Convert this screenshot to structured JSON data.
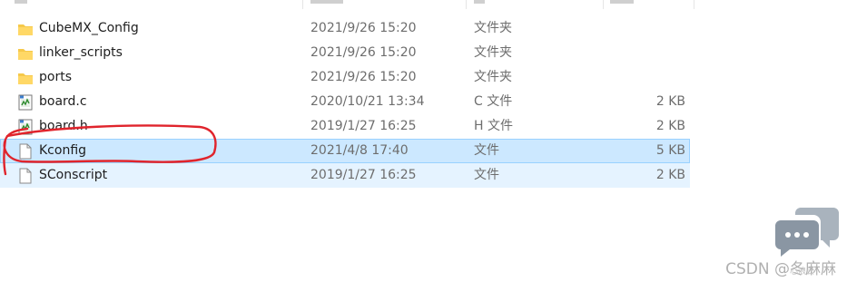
{
  "files": [
    {
      "name": "CubeMX_Config",
      "date": "2021/9/26 15:20",
      "type": "文件夹",
      "size": "",
      "icon": "folder-icon"
    },
    {
      "name": "linker_scripts",
      "date": "2021/9/26 15:20",
      "type": "文件夹",
      "size": "",
      "icon": "folder-icon"
    },
    {
      "name": "ports",
      "date": "2021/9/26 15:20",
      "type": "文件夹",
      "size": "",
      "icon": "folder-icon"
    },
    {
      "name": "board.c",
      "date": "2020/10/21 13:34",
      "type": "C 文件",
      "size": "2 KB",
      "icon": "c-source-file-icon"
    },
    {
      "name": "board.h",
      "date": "2019/1/27 16:25",
      "type": "H 文件",
      "size": "2 KB",
      "icon": "c-source-file-icon"
    },
    {
      "name": "Kconfig",
      "date": "2021/4/8 17:40",
      "type": "文件",
      "size": "5 KB",
      "icon": "blank-file-icon"
    },
    {
      "name": "SConscript",
      "date": "2019/1/27 16:25",
      "type": "文件",
      "size": "2 KB",
      "icon": "blank-file-icon"
    }
  ],
  "watermark": {
    "text": "CSDN @冬麻麻",
    "subtext": "心浪云"
  },
  "colors": {
    "selection": "#cce8ff",
    "selection_border": "#99d1ff",
    "hover": "#e5f3ff",
    "annotation": "#e0242c",
    "folder": "#f6c94a"
  }
}
